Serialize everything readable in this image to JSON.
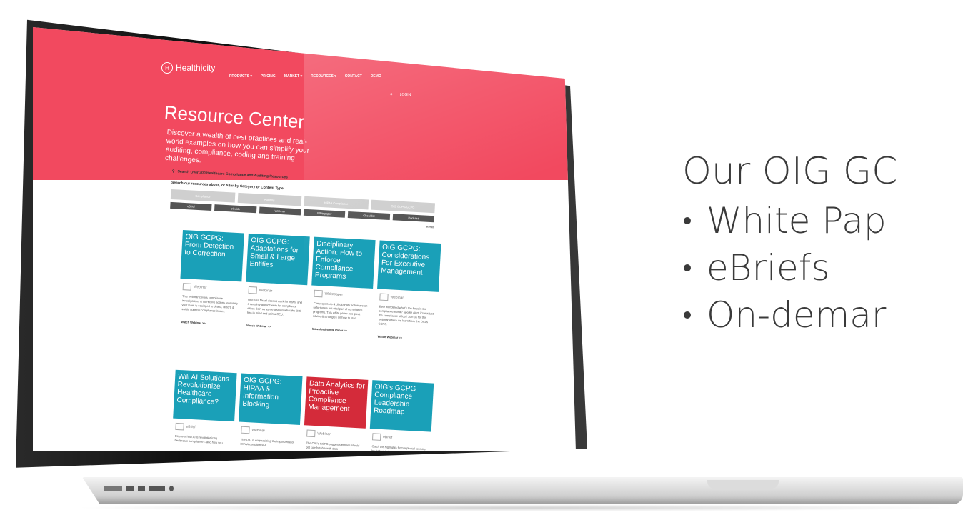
{
  "slide": {
    "heading": "Our OIG GC",
    "bullets": [
      "White Pap",
      "eBriefs",
      "On-demar"
    ]
  },
  "site": {
    "logo": "Healthicity",
    "nav": [
      "PRODUCTS ▾",
      "PRICING",
      "MARKET ▾",
      "RESOURCES ▾",
      "CONTACT",
      "DEMO"
    ],
    "login": "LOGIN",
    "hero_title": "Resource Center",
    "hero_subtitle": "Discover a wealth of best practices and real-world examples on how you can simplify your auditing, compliance, coding and training challenges.",
    "search_label": "Search Over 300 Healthcare Compliance and Auditing Resources",
    "filter_prompt": "Search our resources above, or filter by Category or Content Type:",
    "categories": [
      "Compliance",
      "Auditing",
      "HIPAA Compliance",
      "OIG GCPG/GCPG"
    ],
    "content_types": [
      "eBrief",
      "eGuide",
      "Webinar",
      "Whitepaper",
      "Checklist",
      "Podcast"
    ],
    "reset": "Reset",
    "cards": [
      {
        "title": "OIG GCPG: From Detection to Correction",
        "type": "Webinar",
        "desc": "This webinar covers compliance investigations & corrective actions, ensuring your team is equipped to detect, report, & swiftly address compliance issues.",
        "link": "Watch Webinar >>",
        "color": "#1aa0b8"
      },
      {
        "title": "OIG GCPG: Adaptations for Small & Large Entities",
        "type": "Webinar",
        "desc": "One size fits all doesn't work for jeans, and it certainly doesn't work for compliance either. Join us as we discuss what the OIG has in mind and gain a CEU.",
        "link": "Watch Webinar >>",
        "color": "#1aa0b8"
      },
      {
        "title": "Disciplinary Action: How to Enforce Compliance Programs",
        "type": "Whitepaper",
        "desc": "Consequences & disciplinary action are an unfortunate but vital part of compliance programs. This white paper has great advice & strategies on how to start.",
        "link": "Download White Paper >>",
        "color": "#1aa0b8"
      },
      {
        "title": "OIG GCPG: Considerations For Executive Management",
        "type": "Webinar",
        "desc": "Ever wondered what's the boss in the compliance world? Spoiler alert, it's not just the compliance officer! Join us for this webinar where we learn from the OIG's GCPG.",
        "link": "Watch Webinar >>",
        "color": "#1aa0b8"
      },
      {
        "title": "Will AI Solutions Revolutionize Healthcare Compliance?",
        "type": "eBrief",
        "desc": "Discover how AI is revolutionizing healthcare compliance – and how you",
        "link": "",
        "color": "#1aa0b8"
      },
      {
        "title": "OIG GCPG: HIPAA & Information Blocking",
        "type": "Webinar",
        "desc": "The OIG is emphasizing the importance of HIPAA compliance &",
        "link": "",
        "color": "#1aa0b8"
      },
      {
        "title": "Data Analytics for Proactive Compliance Management",
        "type": "Webinar",
        "desc": "The OIG's GCPG suggests entities should get comfortable with data",
        "link": "",
        "color": "#d42b3a"
      },
      {
        "title": "OIG's GCPG Compliance Leadership Roadmap",
        "type": "eBrief",
        "desc": "Catch the highlights from a pivotal keynote by Robert A. DeConti and",
        "link": "",
        "color": "#1aa0b8"
      }
    ]
  }
}
